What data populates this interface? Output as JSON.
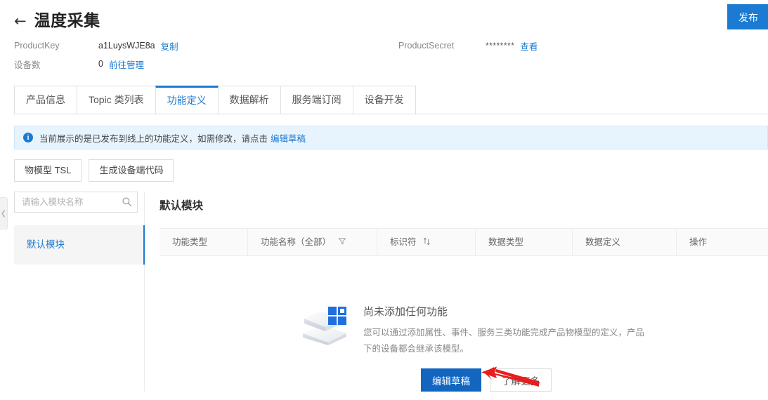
{
  "header": {
    "back_icon": "back-arrow-icon",
    "title": "温度采集",
    "publish_label": "发布"
  },
  "meta": {
    "product_key_label": "ProductKey",
    "product_key_value": "a1LuysWJE8a",
    "product_key_copy": "复制",
    "device_count_label": "设备数",
    "device_count_value": "0",
    "device_count_link": "前往管理",
    "product_secret_label": "ProductSecret",
    "product_secret_value": "********",
    "product_secret_view": "查看"
  },
  "tabs": [
    {
      "label": "产品信息",
      "active": false
    },
    {
      "label": "Topic 类列表",
      "active": false
    },
    {
      "label": "功能定义",
      "active": true
    },
    {
      "label": "数据解析",
      "active": false
    },
    {
      "label": "服务端订阅",
      "active": false
    },
    {
      "label": "设备开发",
      "active": false
    }
  ],
  "banner": {
    "icon": "info-circle-icon",
    "text": "当前展示的是已发布到线上的功能定义，如需修改，请点击",
    "link": "编辑草稿"
  },
  "actions": {
    "tsl_label": "物模型 TSL",
    "gen_code_label": "生成设备端代码"
  },
  "sidebar": {
    "collapse_icon": "chevron-left-icon",
    "search_placeholder": "请输入模块名称",
    "search_value": "",
    "search_icon": "search-icon",
    "items": [
      {
        "label": "默认模块",
        "selected": true
      }
    ]
  },
  "main": {
    "module_title": "默认模块",
    "table": {
      "columns": [
        {
          "label": "功能类型",
          "icon": ""
        },
        {
          "label": "功能名称（全部）",
          "icon": "filter-icon"
        },
        {
          "label": "标识符",
          "icon": "sort-icon"
        },
        {
          "label": "数据类型",
          "icon": ""
        },
        {
          "label": "数据定义",
          "icon": ""
        },
        {
          "label": "操作",
          "icon": ""
        }
      ],
      "rows": []
    },
    "empty_state": {
      "illustration": "stacked-boxes-illustration",
      "title": "尚未添加任何功能",
      "description": "您可以通过添加属性、事件、服务三类功能完成产品物模型的定义，产品下的设备都会继承该模型。",
      "primary_label": "编辑草稿",
      "secondary_label": "了解更多",
      "annotation_icon": "red-arrow-annotation"
    }
  },
  "colors": {
    "accent": "#1b7ad1",
    "primary_button": "#1266c0",
    "banner_bg": "#e8f4fd",
    "annotation_red": "#e81e1e"
  }
}
